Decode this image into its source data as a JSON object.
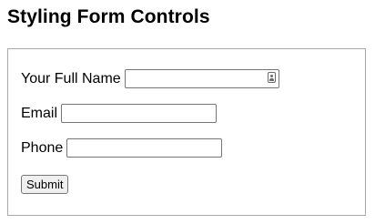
{
  "page": {
    "title": "Styling Form Controls"
  },
  "form": {
    "fields": [
      {
        "label": "Your Full Name",
        "value": "",
        "placeholder": "",
        "icon": "contact-autofill-icon"
      },
      {
        "label": "Email",
        "value": "",
        "placeholder": ""
      },
      {
        "label": "Phone",
        "value": "",
        "placeholder": ""
      }
    ],
    "submit_label": "Submit"
  },
  "colors": {
    "border": "#a9a9a9",
    "input_border": "#767676",
    "button_bg": "#efefef"
  }
}
